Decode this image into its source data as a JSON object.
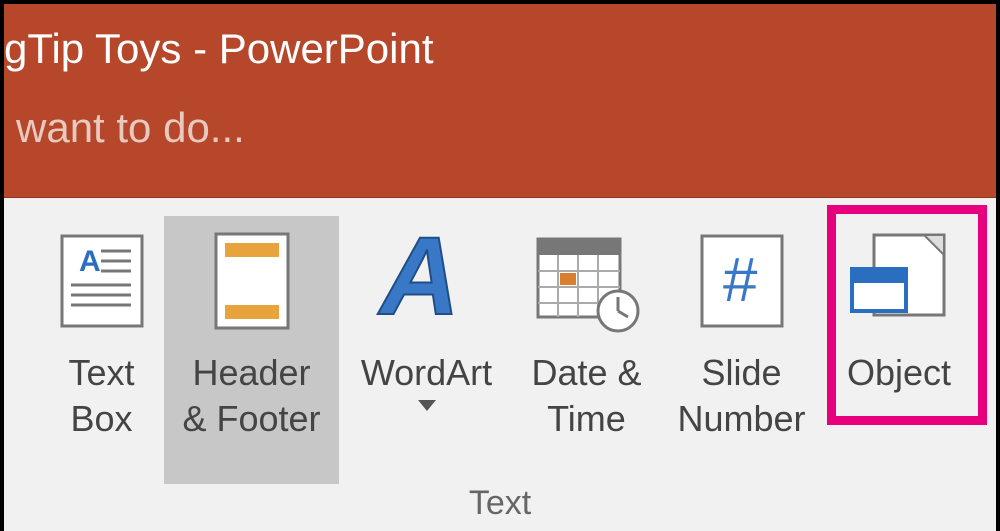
{
  "title": "gTip Toys - PowerPoint",
  "tellme_placeholder": "want to do...",
  "group_label": "Text",
  "buttons": {
    "textbox": {
      "l1": "Text",
      "l2": "Box"
    },
    "headerfooter": {
      "l1": "Header",
      "l2": "& Footer"
    },
    "wordart": {
      "l1": "WordArt",
      "l2": ""
    },
    "datetime": {
      "l1": "Date &",
      "l2": "Time"
    },
    "slidenum": {
      "l1": "Slide",
      "l2": "Number"
    },
    "object": {
      "l1": "Object",
      "l2": ""
    }
  }
}
